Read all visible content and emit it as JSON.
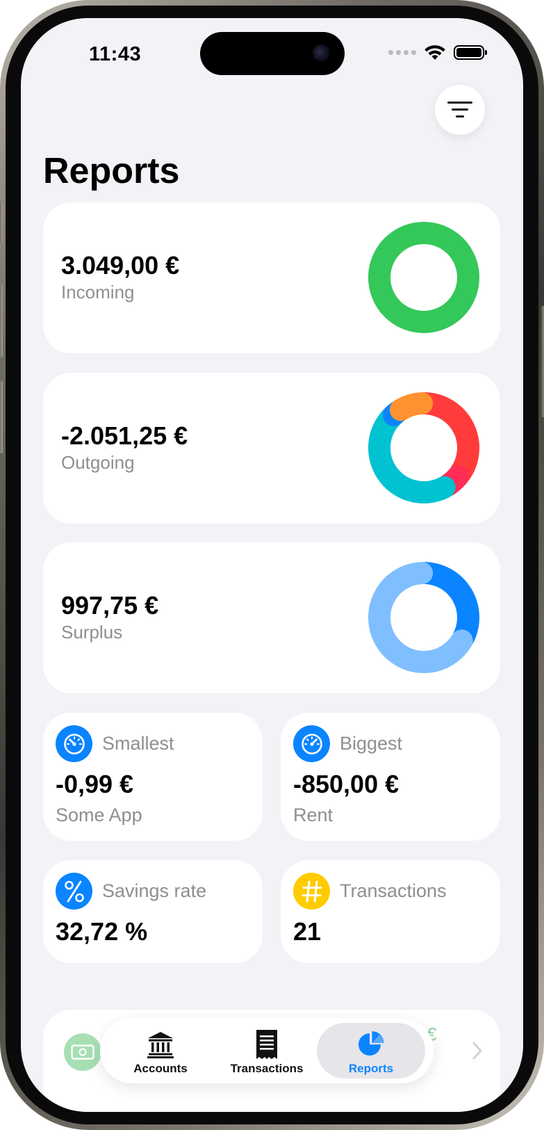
{
  "status_bar": {
    "time": "11:43"
  },
  "header": {
    "title": "Reports",
    "filter_icon": "filter-lines-icon"
  },
  "summary": {
    "incoming": {
      "amount": "3.049,00 €",
      "label": "Incoming",
      "color": "#34c759"
    },
    "outgoing": {
      "amount": "-2.051,25 €",
      "label": "Outgoing"
    },
    "surplus": {
      "amount": "997,75 €",
      "label": "Surplus"
    }
  },
  "stats": {
    "smallest": {
      "title": "Smallest",
      "value": "-0,99 €",
      "subtitle": "Some App",
      "icon": "gauge-icon",
      "color": "#0a84ff"
    },
    "biggest": {
      "title": "Biggest",
      "value": "-850,00 €",
      "subtitle": "Rent",
      "icon": "gauge-icon",
      "color": "#0a84ff"
    },
    "savings_rate": {
      "title": "Savings rate",
      "value": "32,72 %",
      "icon": "percent-icon",
      "color": "#0a84ff"
    },
    "transactions": {
      "title": "Transactions",
      "value": "21",
      "icon": "hash-icon",
      "color": "#ffcc00"
    }
  },
  "peek_card": {
    "euro": "€"
  },
  "tabbar": {
    "tabs": [
      {
        "label": "Accounts",
        "icon": "bank-icon",
        "active": false
      },
      {
        "label": "Transactions",
        "icon": "receipt-icon",
        "active": false
      },
      {
        "label": "Reports",
        "icon": "pie-chart-icon",
        "active": true
      }
    ],
    "active_color": "#0a84ff"
  },
  "chart_data": [
    {
      "type": "pie",
      "title": "",
      "slices": [
        {
          "value": 100,
          "color": "#34c759"
        }
      ]
    },
    {
      "type": "pie",
      "title": "",
      "slices": [
        {
          "value": 34,
          "color": "#ff3b3b"
        },
        {
          "value": 6,
          "color": "#ff2d55"
        },
        {
          "value": 44,
          "color": "#00c2d1"
        },
        {
          "value": 3,
          "color": "#0a84ff"
        },
        {
          "value": 9,
          "color": "#ff9230"
        }
      ]
    },
    {
      "type": "pie",
      "title": "",
      "slices": [
        {
          "value": 33,
          "color": "#0a84ff"
        },
        {
          "value": 67,
          "color": "#7fbfff"
        }
      ]
    }
  ]
}
